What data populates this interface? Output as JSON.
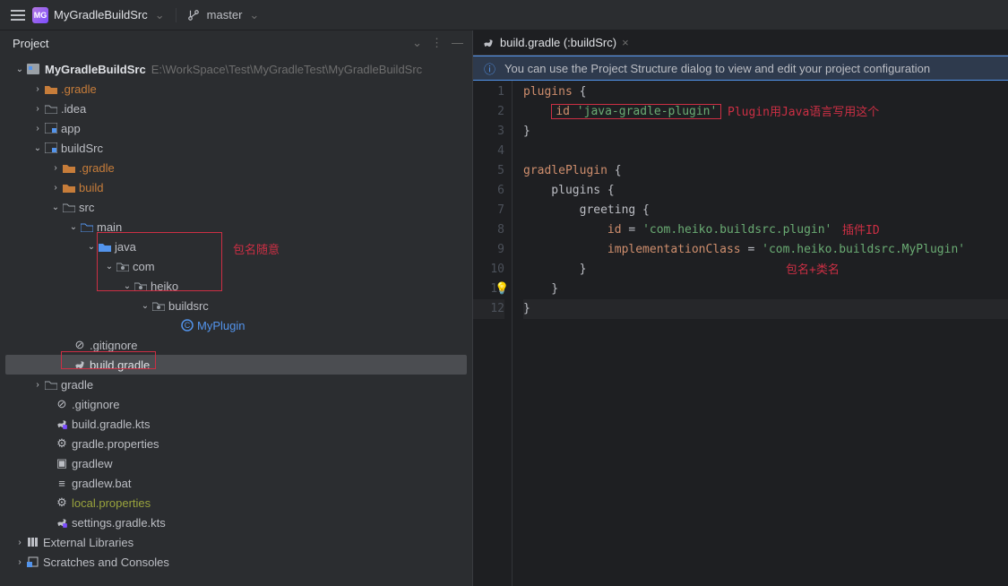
{
  "topbar": {
    "project_initials": "MG",
    "project_name": "MyGradleBuildSrc",
    "branch": "master"
  },
  "left": {
    "header": "Project",
    "root_label": "MyGradleBuildSrc",
    "root_path": "E:\\WorkSpace\\Test\\MyGradleTest\\MyGradleBuildSrc",
    "nodes": {
      "gradle_excluded": ".gradle",
      "idea": ".idea",
      "app": "app",
      "buildSrc": "buildSrc",
      "buildSrc_gradle": ".gradle",
      "buildSrc_build": "build",
      "buildSrc_src": "src",
      "main": "main",
      "java": "java",
      "com": "com",
      "heiko": "heiko",
      "buildsrc": "buildsrc",
      "myplugin": "MyPlugin",
      "gitignore1": ".gitignore",
      "buildgradle": "build.gradle",
      "gradle": "gradle",
      "gitignore2": ".gitignore",
      "buildgradlekts": "build.gradle.kts",
      "gradleproperties": "gradle.properties",
      "gradlew": "gradlew",
      "gradlewbat": "gradlew.bat",
      "localprops": "local.properties",
      "settingsgradlekts": "settings.gradle.kts",
      "extlibs": "External Libraries",
      "scratches": "Scratches and Consoles"
    },
    "annotations": {
      "package_any": "包名随意"
    }
  },
  "editor": {
    "tab": "build.gradle (:buildSrc)",
    "banner": "You can use the Project Structure dialog to view and edit your project configuration",
    "lines": {
      "l1": {
        "k": "plugins",
        "t": " {"
      },
      "l2": {
        "prefix": "    ",
        "k": "id",
        "s": "'java-gradle-plugin'"
      },
      "l3": {
        "t": "}"
      },
      "l5": {
        "k": "gradlePlugin",
        "t": " {"
      },
      "l6": {
        "t": "    plugins {"
      },
      "l7": {
        "t": "        greeting {"
      },
      "l8": {
        "prefix": "            ",
        "k": "id",
        "t2": " = ",
        "s": "'com.heiko.buildsrc.plugin'"
      },
      "l9": {
        "prefix": "            ",
        "k": "implementationClass",
        "t2": " = ",
        "s": "'com.heiko.buildsrc.MyPlugin'"
      },
      "l10": {
        "t": "        }"
      },
      "l11": {
        "t": "    }"
      },
      "l12": {
        "t": "}"
      }
    },
    "annotations": {
      "a1": "Plugin用Java语言写用这个",
      "a2": "插件ID",
      "a3": "包名+类名"
    },
    "line_numbers": [
      "1",
      "2",
      "3",
      "4",
      "5",
      "6",
      "7",
      "8",
      "9",
      "10",
      "11",
      "12"
    ]
  }
}
